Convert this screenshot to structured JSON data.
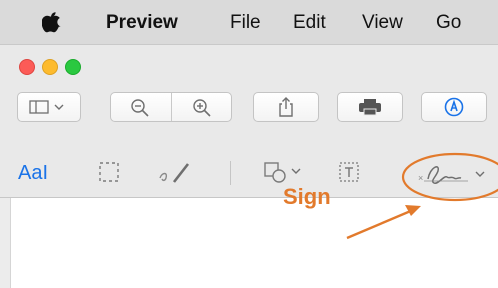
{
  "menubar": {
    "app_name": "Preview",
    "items": [
      "File",
      "Edit",
      "View",
      "Go"
    ]
  },
  "markup_toolbar": {
    "text_tool_label": "AaI"
  },
  "annotation": {
    "label": "Sign",
    "color": "#e27a2c"
  },
  "colors": {
    "menubar_bg": "#dadada",
    "toolbar_bg": "#e9e9e9",
    "accent_blue": "#1a73e8",
    "annotation_orange": "#e27a2c"
  },
  "icons": [
    "apple-logo-icon",
    "sidebar-toggle-icon",
    "zoom-out-icon",
    "zoom-in-icon",
    "share-icon",
    "print-icon",
    "markup-icon",
    "text-selection-icon",
    "rectangular-selection-icon",
    "sketch-icon",
    "shapes-icon",
    "text-box-icon",
    "signature-icon"
  ]
}
